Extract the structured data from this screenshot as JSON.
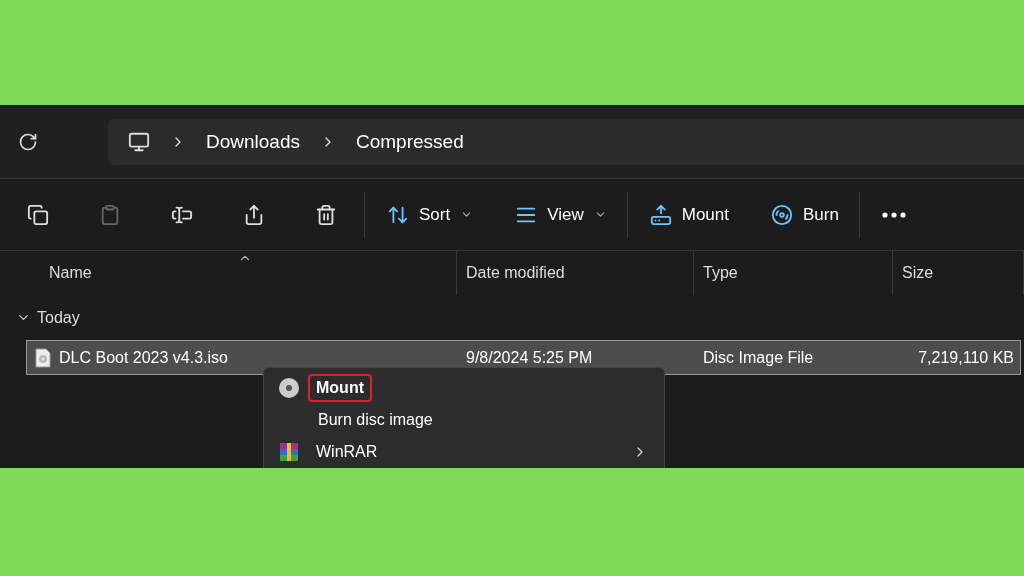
{
  "breadcrumb": [
    "Downloads",
    "Compressed"
  ],
  "toolbar": [
    {
      "kind": "icon",
      "disabled": false
    },
    {
      "kind": "icon",
      "disabled": true
    },
    {
      "kind": "icon",
      "disabled": false
    },
    {
      "kind": "icon",
      "disabled": false
    },
    {
      "kind": "icon",
      "disabled": false
    },
    {
      "kind": "separator"
    },
    {
      "kind": "dropdown",
      "label": "Sort"
    },
    {
      "kind": "dropdown",
      "label": "View"
    },
    {
      "kind": "separator"
    },
    {
      "kind": "button",
      "label": "Mount"
    },
    {
      "kind": "button",
      "label": "Burn"
    },
    {
      "kind": "separator"
    },
    {
      "kind": "more"
    }
  ],
  "table": {
    "columns": [
      "Name",
      "Date modified",
      "Type",
      "Size"
    ],
    "groups": [
      {
        "label": "Today",
        "expanded": true,
        "rows": [
          {
            "name": "DLC Boot 2023 v4.3.iso",
            "date": "9/8/2024 5:25 PM",
            "type": "Disc Image File",
            "size": "7,219,110 KB",
            "selected": true
          }
        ]
      }
    ]
  },
  "context_menu": [
    {
      "label": "Mount",
      "kind": "disc",
      "bold": true,
      "highlighted": true,
      "submenu": false
    },
    {
      "label": "Burn disc image",
      "kind": "plain",
      "bold": false,
      "highlighted": false,
      "submenu": false
    },
    {
      "label": "WinRAR",
      "kind": "archive",
      "bold": false,
      "highlighted": false,
      "submenu": true
    }
  ]
}
